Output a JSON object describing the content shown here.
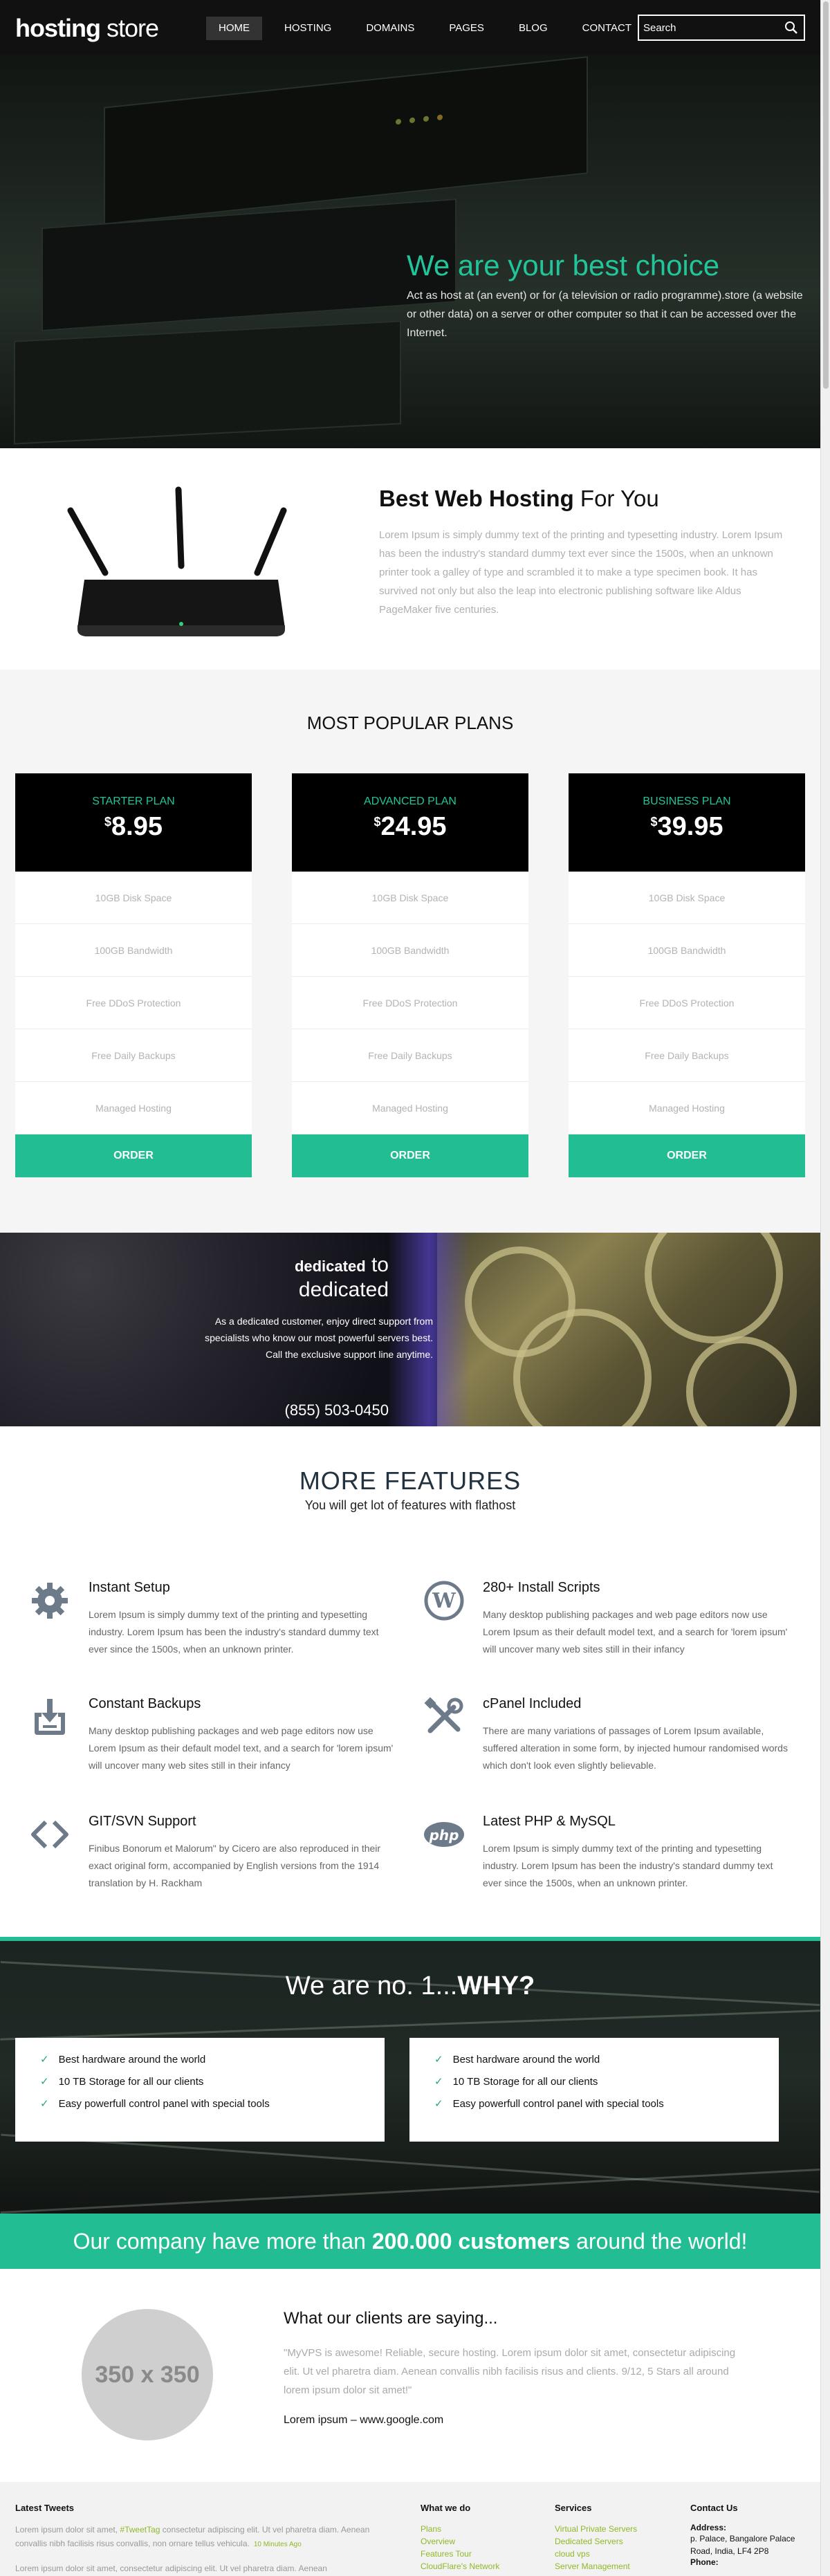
{
  "colors": {
    "accent": "#22bd93",
    "nav_bg": "#111111",
    "plan_head": "#000000",
    "link_green": "#8fb82a"
  },
  "brand": {
    "bold": "hosting",
    "light": " store"
  },
  "nav": {
    "items": [
      "HOME",
      "HOSTING",
      "DOMAINS",
      "PAGES",
      "BLOG",
      "CONTACT"
    ],
    "active": "HOME",
    "search_placeholder": "Search"
  },
  "hero": {
    "title": "We are your best choice",
    "text": "Act as host at (an event) or for (a television or radio programme).store (a website or other data) on a server or other computer so that it can be accessed over the Internet."
  },
  "intro": {
    "title_bold": "Best Web Hosting",
    "title_light": " For You",
    "text": "Lorem Ipsum is simply dummy text of the printing and typesetting industry. Lorem Ipsum has been the industry's standard dummy text ever since the 1500s, when an unknown printer took a galley of type and scrambled it to make a type specimen book. It has survived not only but also the leap into electronic publishing software like Aldus PageMaker five centuries."
  },
  "plans": {
    "title": "MOST POPULAR PLANS",
    "items": [
      {
        "name": "STARTER PLAN",
        "currency": "$",
        "price": "8.95",
        "features": [
          "10GB Disk Space",
          "100GB Bandwidth",
          "Free DDoS Protection",
          "Free Daily Backups",
          "Managed Hosting"
        ],
        "button": "ORDER"
      },
      {
        "name": "ADVANCED PLAN",
        "currency": "$",
        "price": "24.95",
        "features": [
          "10GB Disk Space",
          "100GB Bandwidth",
          "Free DDoS Protection",
          "Free Daily Backups",
          "Managed Hosting"
        ],
        "button": "ORDER"
      },
      {
        "name": "BUSINESS PLAN",
        "currency": "$",
        "price": "39.95",
        "features": [
          "10GB Disk Space",
          "100GB Bandwidth",
          "Free DDoS Protection",
          "Free Daily Backups",
          "Managed Hosting"
        ],
        "button": "ORDER"
      }
    ]
  },
  "dedicated": {
    "title_small": "dedicated",
    "title_to": " to",
    "title_big": "dedicated",
    "text": "As a dedicated customer, enjoy direct support from specialists who know our most powerful servers best. Call the exclusive support line anytime.",
    "phone": "(855) 503-0450"
  },
  "features": {
    "title": "MORE FEATURES",
    "subtitle": "You will get lot of features with flathost",
    "items": [
      {
        "icon": "gear-icon",
        "title": "Instant Setup",
        "text": "Lorem Ipsum is simply dummy text of the printing and typesetting industry. Lorem Ipsum has been the industry's standard dummy text ever since the 1500s, when an unknown printer."
      },
      {
        "icon": "wordpress-icon",
        "title": "280+ Install Scripts",
        "text": "Many desktop publishing packages and web page editors now use Lorem Ipsum as their default model text, and a search for 'lorem ipsum' will uncover many web sites still in their infancy"
      },
      {
        "icon": "backup-icon",
        "title": "Constant Backups",
        "text": "Many desktop publishing packages and web page editors now use Lorem Ipsum as their default model text, and a search for 'lorem ipsum' will uncover many web sites still in their infancy"
      },
      {
        "icon": "tools-icon",
        "title": "cPanel Included",
        "text": "There are many variations of passages of Lorem Ipsum available, suffered alteration in some form, by injected humour randomised words which don't look even slightly believable."
      },
      {
        "icon": "code-icon",
        "title": "GIT/SVN Support",
        "text": "Finibus Bonorum et Malorum\" by Cicero are also reproduced in their exact original form, accompanied by English versions from the 1914 translation by H. Rackham"
      },
      {
        "icon": "php-icon",
        "title": "Latest PHP & MySQL",
        "text": "Lorem Ipsum is simply dummy text of the printing and typesetting industry. Lorem Ipsum has been the industry's standard dummy text ever since the 1500s, when an unknown printer."
      }
    ]
  },
  "why": {
    "title_light": "We are no. 1...",
    "title_bold": "WHY?",
    "boxes": [
      [
        "Best hardware around the world",
        "10 TB Storage for all our clients",
        "Easy powerfull control panel with special tools"
      ],
      [
        "Best hardware around the world",
        "10 TB Storage for all our clients",
        "Easy powerfull control panel with special tools"
      ]
    ]
  },
  "customers": {
    "pre": "Our company have more than ",
    "bold": "200.000 customers",
    "post": " around the world!"
  },
  "testimonial": {
    "avatar_text": "350 x 350",
    "title": "What our clients are saying...",
    "quote": "\"MyVPS is awesome! Reliable, secure hosting. Lorem ipsum dolor sit amet, consectetur adipiscing elit. Ut vel pharetra diam. Aenean convallis nibh facilisis risus and clients. 9/12, 5 Stars all around lorem ipsum dolor sit amet!\"",
    "author": "Lorem ipsum – www.google.com"
  },
  "footer": {
    "tweets_title": "Latest Tweets",
    "tweets": [
      {
        "pre": "Lorem ipsum dolor sit amet, ",
        "tag": "#TweetTag",
        "post": " consectetur adipiscing elit. Ut vel pharetra diam. Aenean convallis nibh facilisis risus convallis, non ornare tellus vehicula.",
        "ago": "10 Minutes Ago"
      },
      {
        "pre": "Lorem ipsum dolor sit amet, consectetur adipiscing elit. Ut vel pharetra diam. Aenean",
        "tag": "",
        "post": "",
        "ago": ""
      }
    ],
    "what_title": "What we do",
    "what": [
      "Plans",
      "Overview",
      "Features Tour",
      "CloudFlare's Network"
    ],
    "services_title": "Services",
    "services": [
      "Virtual Private Servers",
      "Dedicated Servers",
      "cloud vps",
      "Server Management"
    ],
    "contact_title": "Contact Us",
    "address_label": "Address:",
    "address": [
      "p. Palace, Bangalore Palace",
      "Road, India, LF4 2P8"
    ],
    "phone_label": "Phone:"
  }
}
